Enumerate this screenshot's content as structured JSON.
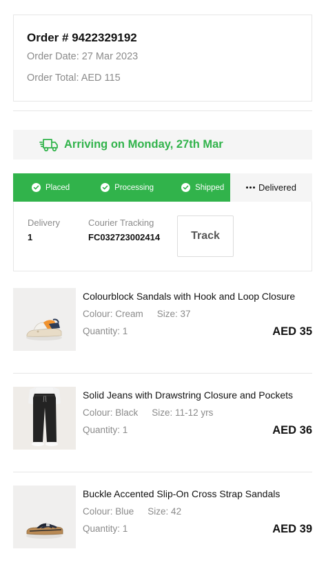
{
  "order": {
    "number_label": "Order # 9422329192",
    "date_label": "Order Date: 27 Mar 2023",
    "total_label": "Order Total: AED 115"
  },
  "shipment": {
    "arriving_text": "Arriving on Monday, 27th Mar",
    "accent_color": "#31b34b",
    "steps": [
      {
        "label": "Placed",
        "done": true
      },
      {
        "label": "Processing",
        "done": true
      },
      {
        "label": "Shipped",
        "done": true
      },
      {
        "label": "Delivered",
        "done": false
      }
    ],
    "delivery_label": "Delivery",
    "delivery_value": "1",
    "courier_label": "Courier Tracking",
    "courier_value": "FC032723002414",
    "track_button": "Track"
  },
  "items": [
    {
      "name": "Colourblock Sandals with Hook and Loop Closure",
      "colour": "Colour: Cream",
      "size": "Size: 37",
      "quantity": "Quantity: 1",
      "price": "AED 35",
      "thumbnail_icon": "sandal-thumbnail"
    },
    {
      "name": "Solid Jeans with Drawstring Closure and Pockets",
      "colour": "Colour: Black",
      "size": "Size: 11-12 yrs",
      "quantity": "Quantity: 1",
      "price": "AED 36",
      "thumbnail_icon": "jeans-thumbnail"
    },
    {
      "name": "Buckle Accented Slip-On Cross Strap Sandals",
      "colour": "Colour: Blue",
      "size": "Size: 42",
      "quantity": "Quantity: 1",
      "price": "AED 39",
      "thumbnail_icon": "slide-sandal-thumbnail"
    }
  ]
}
